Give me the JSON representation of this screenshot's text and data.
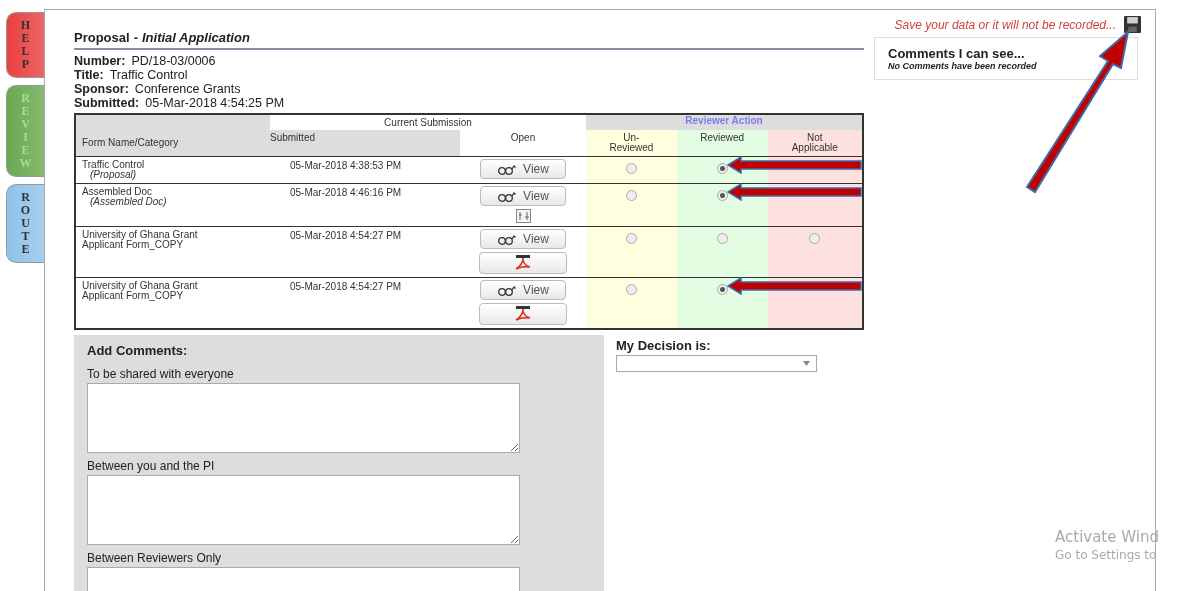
{
  "side_tabs": [
    {
      "label": "HELP",
      "color": "#e8403f",
      "selected": false
    },
    {
      "label": "REVIEW",
      "color": "#6aa84f",
      "selected": true
    },
    {
      "label": "ROUTE",
      "color": "#8fc3ea",
      "selected": false
    }
  ],
  "save_notice": "Save your data or it will not be recorded...",
  "header": {
    "title": "Proposal",
    "separator": "-",
    "subtitle": "Initial Application",
    "fields": [
      {
        "label": "Number:",
        "value": "PD/18-03/0006"
      },
      {
        "label": "Title:",
        "value": "Traffic Control"
      },
      {
        "label": "Sponsor:",
        "value": "Conference Grants"
      },
      {
        "label": "Submitted:",
        "value": "05-Mar-2018 4:54:25 PM"
      }
    ]
  },
  "comments_box": {
    "title": "Comments I can see...",
    "note": "No Comments have been recorded"
  },
  "table": {
    "group_current": "Current Submission",
    "group_reviewer": "Reviewer Action",
    "columns": [
      "Form Name/Category",
      "Submitted",
      "Open",
      "Un-\nReviewed",
      "Reviewed",
      "Not\nApplicable"
    ],
    "rows": [
      {
        "name": "Traffic Control",
        "category": "(Proposal)",
        "submitted": "05-Mar-2018 4:38:53 PM",
        "view": "View",
        "kind": "plain",
        "options": [
          {
            "selected": false
          },
          {
            "selected": true
          }
        ],
        "flagged": true
      },
      {
        "name": "Assembled Doc",
        "category": "(Assembled Doc)",
        "submitted": "05-Mar-2018 4:46:16 PM",
        "view": "View",
        "kind": "compare",
        "options": [
          {
            "selected": false
          },
          {
            "selected": true
          }
        ],
        "flagged": true
      },
      {
        "name": "University of Ghana Grant\nApplicant Form_COPY",
        "submitted": "05-Mar-2018 4:54:27 PM",
        "view": "View",
        "kind": "pdf",
        "options": [
          {
            "selected": false
          },
          {
            "selected": false
          },
          {
            "selected": false
          }
        ],
        "flagged": false
      },
      {
        "name": "University of Ghana Grant\nApplicant Form_COPY",
        "submitted": "05-Mar-2018 4:54:27 PM",
        "view": "View",
        "kind": "pdf",
        "options": [
          {
            "selected": false
          },
          {
            "selected": true
          }
        ],
        "flagged": true
      }
    ]
  },
  "add_comments": {
    "title": "Add Comments:",
    "fields": [
      "To be shared with everyone",
      "Between you and the PI",
      "Between Reviewers Only"
    ]
  },
  "decision": {
    "label": "My Decision is:"
  },
  "activation": {
    "title": "Activate Wind",
    "subtitle": "Go to Settings to"
  }
}
